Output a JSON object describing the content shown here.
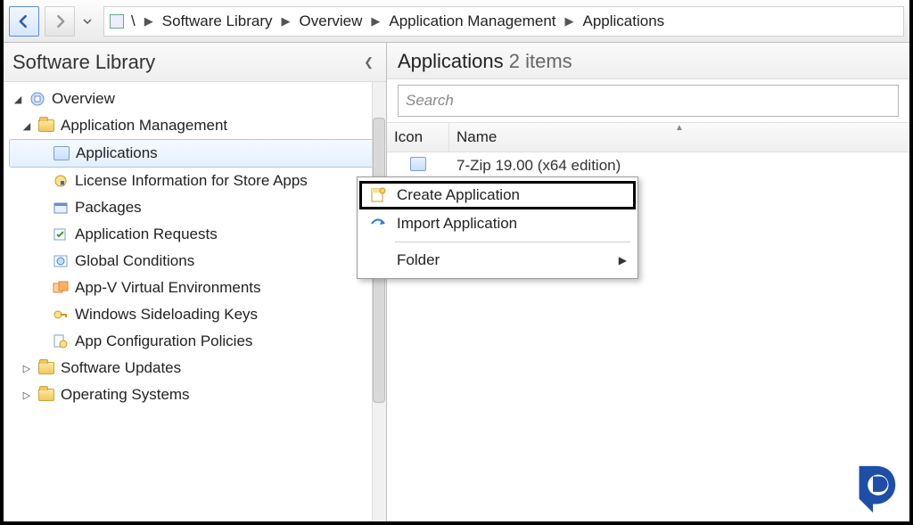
{
  "breadcrumb": {
    "root": "\\",
    "items": [
      "Software Library",
      "Overview",
      "Application Management",
      "Applications"
    ]
  },
  "sidebar": {
    "title": "Software Library",
    "items": [
      {
        "label": "Overview",
        "icon": "overview",
        "level": 0,
        "expanded": true
      },
      {
        "label": "Application Management",
        "icon": "folder",
        "level": 1,
        "expanded": true
      },
      {
        "label": "Applications",
        "icon": "app",
        "level": 2,
        "selected": true
      },
      {
        "label": "License Information for Store Apps",
        "icon": "license",
        "level": 2
      },
      {
        "label": "Packages",
        "icon": "package",
        "level": 2
      },
      {
        "label": "Application Requests",
        "icon": "request",
        "level": 2
      },
      {
        "label": "Global Conditions",
        "icon": "globe",
        "level": 2
      },
      {
        "label": "App-V Virtual Environments",
        "icon": "appv",
        "level": 2
      },
      {
        "label": "Windows Sideloading Keys",
        "icon": "key",
        "level": 2
      },
      {
        "label": "App Configuration Policies",
        "icon": "policy",
        "level": 2
      },
      {
        "label": "Software Updates",
        "icon": "folder",
        "level": 1,
        "expanded": false
      },
      {
        "label": "Operating Systems",
        "icon": "folder",
        "level": 1,
        "expanded": false
      }
    ]
  },
  "main": {
    "title": "Applications",
    "count_label": "2 items",
    "search_placeholder": "Search",
    "columns": {
      "icon": "Icon",
      "name": "Name"
    },
    "rows": [
      {
        "name": "7-Zip 19.00 (x64 edition)"
      }
    ]
  },
  "context_menu": {
    "items": [
      {
        "label": "Create Application",
        "icon": "create",
        "highlight": true
      },
      {
        "label": "Import Application",
        "icon": "import"
      }
    ],
    "submenu_label": "Folder"
  }
}
